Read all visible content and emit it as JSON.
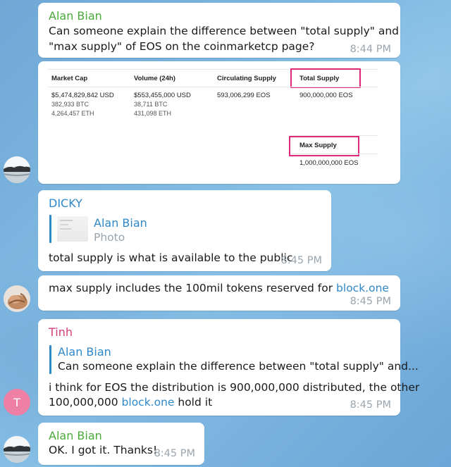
{
  "messages": {
    "m1": {
      "sender": "Alan Bian",
      "line1": "Can someone explain the difference between \"total supply\" and",
      "line2": "\"max supply\" of EOS on the coinmarketcp page?",
      "time": "8:44 PM"
    },
    "shot": {
      "headers": [
        "Market Cap",
        "Volume (24h)",
        "Circulating Supply",
        "Total Supply"
      ],
      "market_cap": [
        "$5,474,829,842 USD",
        "382,933 BTC",
        "4,264,457 ETH"
      ],
      "volume": [
        "$553,455,000 USD",
        "38,711 BTC",
        "431,098 ETH"
      ],
      "circulating": "593,006,299 EOS",
      "total": "900,000,000 EOS",
      "max_label": "Max Supply",
      "max_value": "1,000,000,000 EOS",
      "highlight_color": "#e0287a"
    },
    "m2": {
      "sender": "DICKY",
      "reply_name": "Alan Bian",
      "reply_text": "Photo",
      "text": "total supply is what is available to the public",
      "time": "8:45 PM"
    },
    "m3": {
      "text_pre": "max supply includes the 100mil tokens reserved for ",
      "link": "block.one",
      "time": "8:45 PM"
    },
    "m4": {
      "sender": "Tinh",
      "reply_name": "Alan Bian",
      "reply_text": "Can someone explain the difference between \"total supply\" and...",
      "line1": "i think for EOS the distribution is 900,000,000 distributed, the other",
      "line2_pre": "100,000,000 ",
      "line2_link": "block.one",
      "line2_post": " hold it",
      "time": "8:45 PM",
      "avatar_letter": "T"
    },
    "m5": {
      "sender": "Alan Bian",
      "text": "OK. I got it. Thanks!",
      "time": "8:45 PM"
    }
  },
  "colors": {
    "alan": "#4aab3a",
    "dicky": "#2f88c8",
    "tinh": "#d6407a",
    "link": "#2f88c8",
    "tinh_avatar": "#ee7fa5"
  }
}
